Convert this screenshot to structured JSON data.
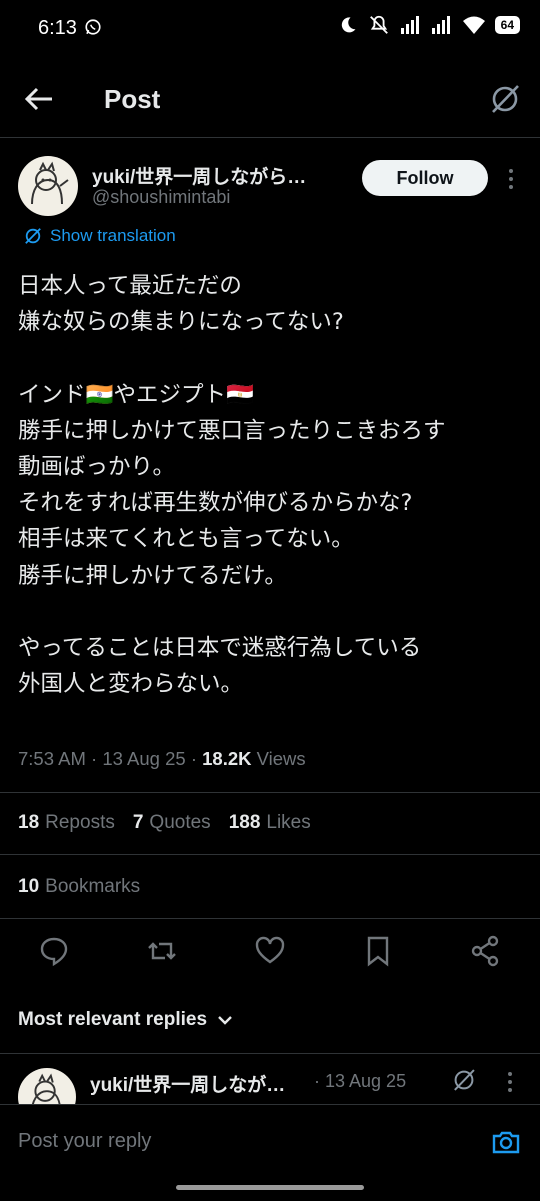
{
  "status_bar": {
    "time": "6:13",
    "battery": "64"
  },
  "header": {
    "title": "Post"
  },
  "author": {
    "name": "yuki/世界一周しながら…",
    "handle": "@shoushimintabi",
    "follow_label": "Follow"
  },
  "translation": {
    "label": "Show translation"
  },
  "post": {
    "text": "日本人って最近ただの\n嫌な奴らの集まりになってない?\n\nインド🇮🇳やエジプト🇪🇬\n勝手に押しかけて悪口言ったりこきおろす\n動画ばっかり。\nそれをすれば再生数が伸びるからかな?\n相手は来てくれとも言ってない。\n勝手に押しかけてるだけ。\n\nやってることは日本で迷惑行為している\n外国人と変わらない。"
  },
  "meta": {
    "time": "7:53 AM",
    "date": "13 Aug 25",
    "views_count": "18.2K",
    "views_label": "Views"
  },
  "stats": {
    "reposts_count": "18",
    "reposts_label": "Reposts",
    "quotes_count": "7",
    "quotes_label": "Quotes",
    "likes_count": "188",
    "likes_label": "Likes",
    "bookmarks_count": "10",
    "bookmarks_label": "Bookmarks"
  },
  "replies": {
    "sort_label": "Most relevant replies"
  },
  "reply_preview": {
    "name": "yuki/世界一周しなが…",
    "date": "· 13 Aug 25"
  },
  "reply_bar": {
    "placeholder": "Post your reply"
  },
  "icons": [
    "whatsapp-icon",
    "moon-icon",
    "mute-icon",
    "signal-icon",
    "wifi-icon",
    "battery-icon",
    "back-arrow-icon",
    "grok-icon",
    "more-icon",
    "translate-icon",
    "reply-icon",
    "repost-icon",
    "like-icon",
    "bookmark-icon",
    "share-icon",
    "chevron-down-icon",
    "camera-icon"
  ],
  "colors": {
    "background": "#000000",
    "text": "#e7e9ea",
    "muted": "#71767b",
    "accent": "#1d9bf0",
    "divider": "#2f3336"
  }
}
